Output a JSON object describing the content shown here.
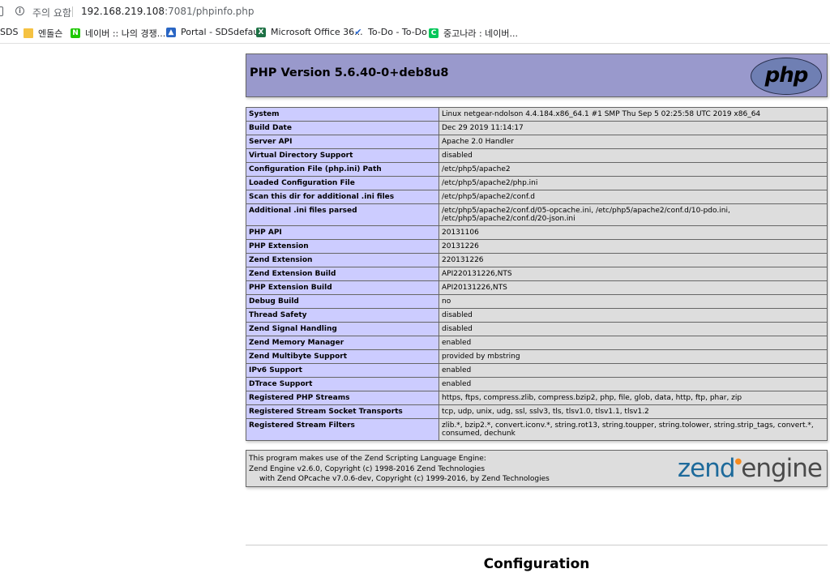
{
  "browser": {
    "security_warning": "주의 요함",
    "url_host": "192.168.219.108",
    "url_path": ":7081/phpinfo.php"
  },
  "bookmarks": [
    {
      "label": "SDS",
      "icon": "bookmark-icon"
    },
    {
      "label": "엔돌슨",
      "icon": "folder-icon",
      "color": "#f5c242"
    },
    {
      "label": "네이버 :: 나의 경쟁...",
      "icon": "naver-icon",
      "color": "#1ec800",
      "glyph": "N"
    },
    {
      "label": "Portal - SDSdefault",
      "icon": "portal-icon",
      "color": "#2a66c4"
    },
    {
      "label": "Microsoft Office 36...",
      "icon": "excel-icon",
      "color": "#1e7145",
      "glyph": "X"
    },
    {
      "label": "To-Do - To-Do",
      "icon": "checkmark-icon",
      "color": "#2564cf",
      "glyph": "✔"
    },
    {
      "label": "중고나라 : 네이버...",
      "icon": "cafe-icon",
      "color": "#03c75a",
      "glyph": "C"
    }
  ],
  "php": {
    "title": "PHP Version 5.6.40-0+deb8u8",
    "logo_text": "php"
  },
  "info_rows": [
    {
      "key": "System",
      "value": "Linux netgear-ndolson 4.4.184.x86_64.1 #1 SMP Thu Sep 5 02:25:58 UTC 2019 x86_64"
    },
    {
      "key": "Build Date",
      "value": "Dec 29 2019 11:14:17"
    },
    {
      "key": "Server API",
      "value": "Apache 2.0 Handler"
    },
    {
      "key": "Virtual Directory Support",
      "value": "disabled"
    },
    {
      "key": "Configuration File (php.ini) Path",
      "value": "/etc/php5/apache2"
    },
    {
      "key": "Loaded Configuration File",
      "value": "/etc/php5/apache2/php.ini"
    },
    {
      "key": "Scan this dir for additional .ini files",
      "value": "/etc/php5/apache2/conf.d"
    },
    {
      "key": "Additional .ini files parsed",
      "value": "/etc/php5/apache2/conf.d/05-opcache.ini, /etc/php5/apache2/conf.d/10-pdo.ini, /etc/php5/apache2/conf.d/20-json.ini"
    },
    {
      "key": "PHP API",
      "value": "20131106"
    },
    {
      "key": "PHP Extension",
      "value": "20131226"
    },
    {
      "key": "Zend Extension",
      "value": "220131226"
    },
    {
      "key": "Zend Extension Build",
      "value": "API220131226,NTS"
    },
    {
      "key": "PHP Extension Build",
      "value": "API20131226,NTS"
    },
    {
      "key": "Debug Build",
      "value": "no"
    },
    {
      "key": "Thread Safety",
      "value": "disabled"
    },
    {
      "key": "Zend Signal Handling",
      "value": "disabled"
    },
    {
      "key": "Zend Memory Manager",
      "value": "enabled"
    },
    {
      "key": "Zend Multibyte Support",
      "value": "provided by mbstring"
    },
    {
      "key": "IPv6 Support",
      "value": "enabled"
    },
    {
      "key": "DTrace Support",
      "value": "enabled"
    },
    {
      "key": "Registered PHP Streams",
      "value": "https, ftps, compress.zlib, compress.bzip2, php, file, glob, data, http, ftp, phar, zip"
    },
    {
      "key": "Registered Stream Socket Transports",
      "value": "tcp, udp, unix, udg, ssl, sslv3, tls, tlsv1.0, tlsv1.1, tlsv1.2"
    },
    {
      "key": "Registered Stream Filters",
      "value": "zlib.*, bzip2.*, convert.iconv.*, string.rot13, string.toupper, string.tolower, string.strip_tags, convert.*, consumed, dechunk"
    }
  ],
  "zend": {
    "line1": "This program makes use of the Zend Scripting Language Engine:",
    "line2": "Zend Engine v2.6.0, Copyright (c) 1998-2016 Zend Technologies",
    "line3": "with Zend OPcache v7.0.6-dev, Copyright (c) 1999-2016, by Zend Technologies",
    "logo_part1": "zend",
    "logo_part2": "engine"
  },
  "section_heading": "Configuration"
}
